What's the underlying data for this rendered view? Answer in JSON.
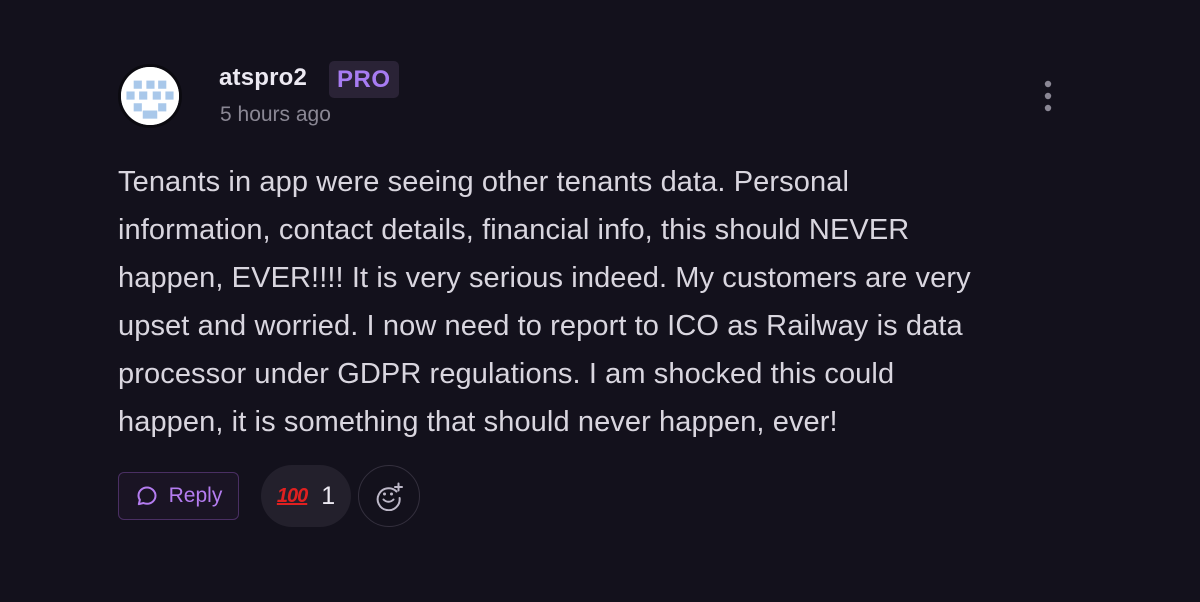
{
  "comment": {
    "author": "atspro2",
    "badge": "PRO",
    "timestamp": "5 hours ago",
    "body_lines": [
      "Tenants in app were seeing other tenants data. Personal",
      "information, contact details, financial info, this should NEVER",
      "happen, EVER!!!! It is very serious indeed. My customers are very",
      "upset and worried. I now need to report to ICO as Railway is data",
      "processor under GDPR regulations. I am shocked this could",
      "happen, it is something that should never happen, ever!"
    ]
  },
  "actions": {
    "reply_label": "Reply",
    "reaction_emoji": "100",
    "reaction_count": "1"
  },
  "icons": {
    "avatar": "identicon-avatar",
    "more": "more-vertical-icon",
    "reply": "chat-bubble-icon",
    "reaction": "hundred-points-emoji",
    "add_reaction": "add-emoji-icon"
  },
  "colors": {
    "background": "#13111c",
    "accent": "#a77cf2",
    "badge_bg": "#2a2336",
    "text": "#d9d6df",
    "muted": "#8a8794"
  }
}
